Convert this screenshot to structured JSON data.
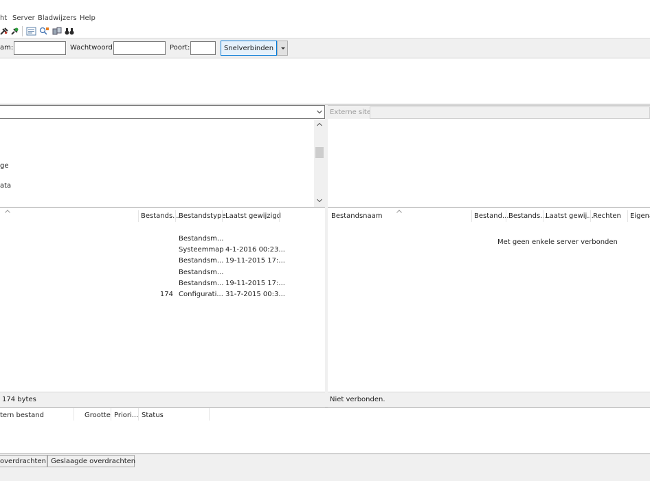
{
  "menu": {
    "items": [
      "ht",
      "Server",
      "Bladwijzers",
      "Help"
    ]
  },
  "toolbar": {
    "icons": [
      "disconnect-icon",
      "reconnect-icon",
      "filter-icon",
      "sync-browse-icon",
      "compare-icon",
      "search-binoculars-icon"
    ]
  },
  "quickconnect": {
    "username_label": "am:",
    "password_label": "Wachtwoord:",
    "port_label": "Poort:",
    "connect_label": "Snelverbinden"
  },
  "local": {
    "path_value": "",
    "tree_items": [
      "ge",
      "ata"
    ],
    "columns": [
      "Bestands...",
      "Bestandstype",
      "Laatst gewijzigd"
    ],
    "rows": [
      {
        "size": "",
        "type": "Bestandsm...",
        "modified": ""
      },
      {
        "size": "",
        "type": "Systeemmap",
        "modified": "4-1-2016 00:23..."
      },
      {
        "size": "",
        "type": "Bestandsm...",
        "modified": "19-11-2015 17:..."
      },
      {
        "size": "",
        "type": "Bestandsm...",
        "modified": ""
      },
      {
        "size": "",
        "type": "Bestandsm...",
        "modified": "19-11-2015 17:..."
      },
      {
        "size": "174",
        "type": "Configurati...",
        "modified": "31-7-2015 00:3..."
      }
    ],
    "status": "174 bytes"
  },
  "remote": {
    "site_label": "Externe site:",
    "columns": [
      "Bestandsnaam",
      "Bestand...",
      "Bestands...",
      "Laatst gewij...",
      "Rechten",
      "Eigena"
    ],
    "empty_message": "Met geen enkele server verbonden",
    "status": "Niet verbonden."
  },
  "queue": {
    "columns": [
      "tern bestand",
      "Grootte",
      "Priori...",
      "Status"
    ],
    "tabs": [
      "overdrachten",
      "Geslaagde overdrachten"
    ]
  }
}
